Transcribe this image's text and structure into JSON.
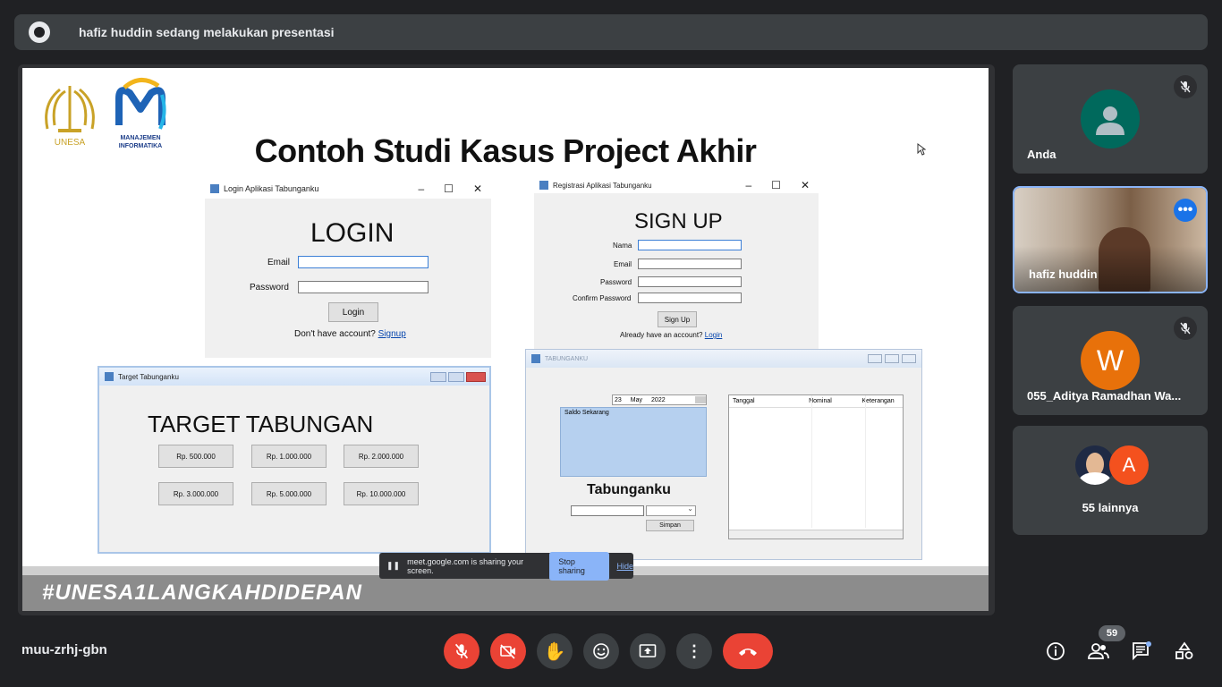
{
  "presenter_bar": {
    "text": "hafiz huddin sedang melakukan presentasi"
  },
  "slide": {
    "logo1_text": "UNESA",
    "logo2_text1": "MANAJEMEN",
    "logo2_text2": "INFORMATIKA",
    "title": "Contoh Studi Kasus Project Akhir",
    "hashtag": "#UNESA1LANGKAHDIDEPAN",
    "login_window": {
      "title": "Login Aplikasi Tabunganku",
      "heading": "LOGIN",
      "email_label": "Email",
      "password_label": "Password",
      "button": "Login",
      "prompt": "Don't have account?",
      "link": "Signup"
    },
    "signup_window": {
      "title": "Registrasi Aplikasi Tabunganku",
      "heading": "SIGN UP",
      "nama_label": "Nama",
      "email_label": "Email",
      "password_label": "Password",
      "confirm_label": "Confirm Password",
      "button": "Sign Up",
      "prompt": "Already have an account?",
      "link": "Login"
    },
    "target_window": {
      "title": "Target Tabunganku",
      "heading": "TARGET TABUNGAN",
      "buttons": [
        "Rp. 500.000",
        "Rp. 1.000.000",
        "Rp. 2.000.000",
        "Rp. 3.000.000",
        "Rp. 5.000.000",
        "Rp. 10.000.000"
      ]
    },
    "tabungan_window": {
      "title": "TABUNGANKU",
      "date_day": "23",
      "date_month": "May",
      "date_year": "2022",
      "saldo_label": "Saldo Sekarang",
      "heading": "Tabunganku",
      "button": "Simpan",
      "columns": [
        "Tanggal",
        "Nominal",
        "Keterangan"
      ]
    }
  },
  "share_notice": {
    "text": "meet.google.com is sharing your screen.",
    "stop": "Stop sharing",
    "hide": "Hide"
  },
  "participants": [
    {
      "name": "Anda",
      "initial": "",
      "muted": true
    },
    {
      "name": "hafiz huddin",
      "initial": "",
      "muted": false
    },
    {
      "name": "055_Aditya Ramadhan Wa...",
      "initial": "W",
      "muted": true
    },
    {
      "name": "55 lainnya",
      "initial": "A",
      "muted": false
    }
  ],
  "controls": {
    "meeting_code": "muu-zrhj-gbn",
    "people_count": "59"
  },
  "colors": {
    "background": "#202124",
    "tile": "#3c4043",
    "danger": "#ea4335",
    "accent": "#8ab4f8",
    "anda_avatar": "#00695c",
    "w_avatar": "#e8710a",
    "a_avatar": "#f4511e"
  }
}
